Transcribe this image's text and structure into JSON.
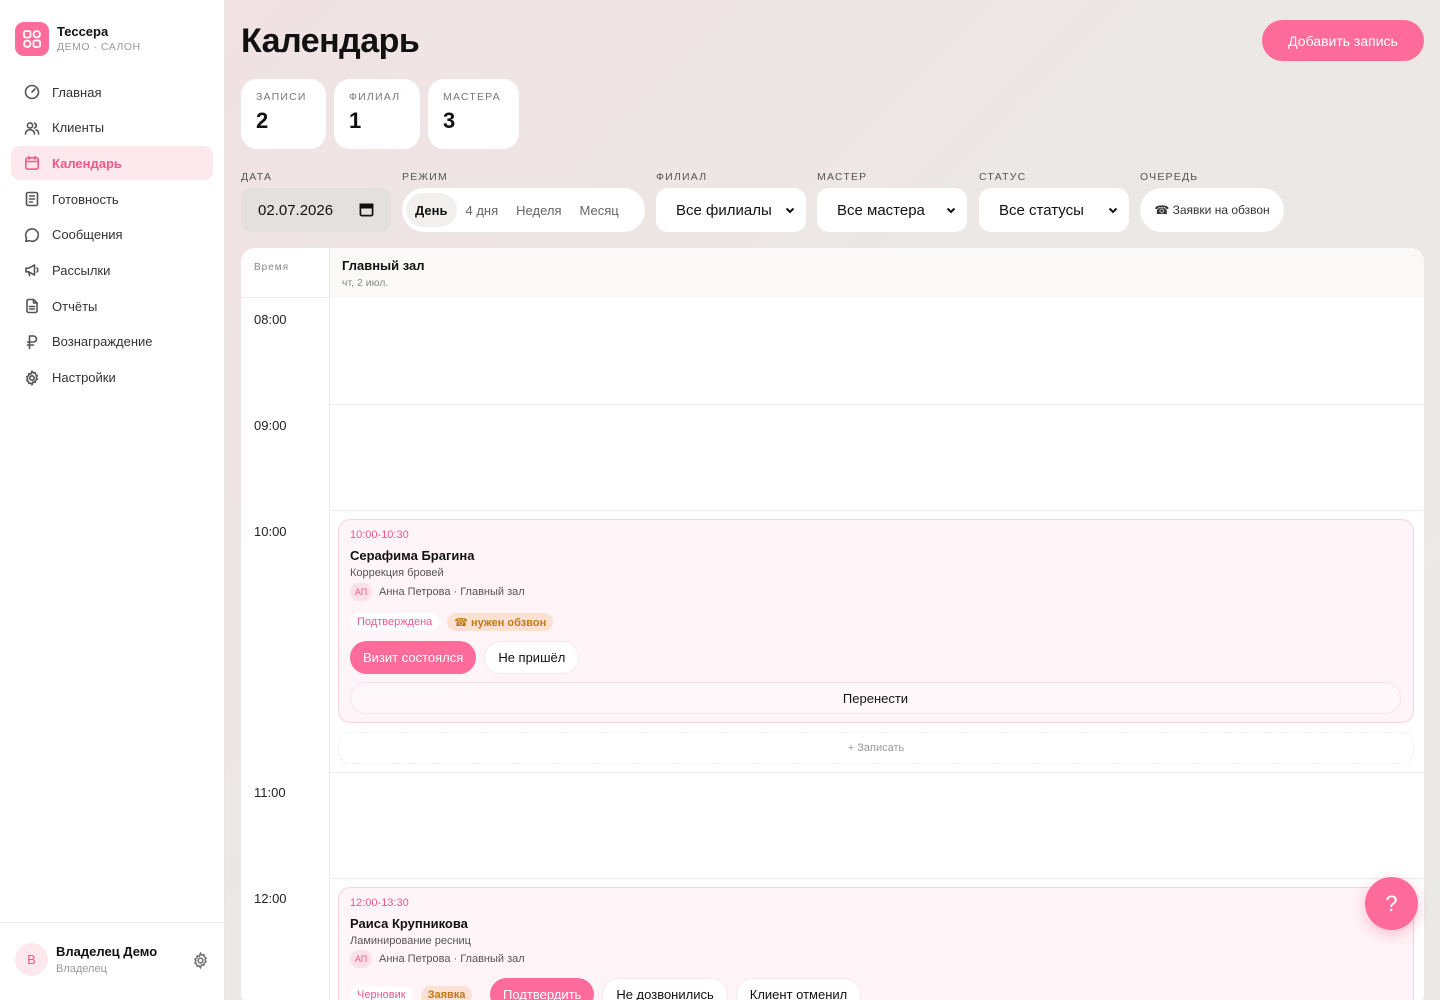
{
  "brand": {
    "name": "Тессера",
    "subtitle": "Демо · салон"
  },
  "nav": [
    {
      "label": "Главная",
      "icon": "gauge-icon"
    },
    {
      "label": "Клиенты",
      "icon": "users-icon"
    },
    {
      "label": "Календарь",
      "icon": "calendar-icon",
      "active": true
    },
    {
      "label": "Готовность",
      "icon": "checklist-icon"
    },
    {
      "label": "Сообщения",
      "icon": "chat-icon"
    },
    {
      "label": "Рассылки",
      "icon": "megaphone-icon"
    },
    {
      "label": "Отчёты",
      "icon": "document-icon"
    },
    {
      "label": "Вознаграждение",
      "icon": "ruble-icon"
    },
    {
      "label": "Настройки",
      "icon": "gear-icon"
    }
  ],
  "user": {
    "initial": "В",
    "name": "Владелец Демо",
    "role": "Владелец"
  },
  "header": {
    "title": "Календарь",
    "add_label": "Добавить запись"
  },
  "stats": [
    {
      "label": "Записи",
      "value": "2"
    },
    {
      "label": "Филиал",
      "value": "1"
    },
    {
      "label": "Мастера",
      "value": "3"
    }
  ],
  "filters": {
    "date_label": "Дата",
    "date_value": "02.07.2026",
    "mode_label": "Режим",
    "modes": [
      "День",
      "4 дня",
      "Неделя",
      "Месяц"
    ],
    "active_mode": "День",
    "branch_label": "Филиал",
    "branch_value": "Все филиалы",
    "master_label": "Мастер",
    "master_value": "Все мастера",
    "status_label": "Статус",
    "status_value": "Все статусы",
    "queue_label": "Очередь",
    "queue_button": "☎ Заявки на обзвон"
  },
  "calendar": {
    "time_header": "Время",
    "room_name": "Главный зал",
    "room_date": "чт, 2 июл.",
    "hours": [
      "08:00",
      "09:00",
      "10:00",
      "11:00",
      "12:00"
    ],
    "book_slot": "+ Записать"
  },
  "appointments": [
    {
      "time": "10:00-10:30",
      "client": "Серафима Брагина",
      "service": "Коррекция бровей",
      "initials": "АП",
      "master": "Анна Петрова · Главный зал",
      "badges": [
        "Подтверждена",
        "☎ нужен обзвон"
      ],
      "buttons": [
        "Визит состоялся",
        "Не пришёл"
      ],
      "move_label": "Перенести"
    },
    {
      "time": "12:00-13:30",
      "client": "Раиса Крупникова",
      "service": "Ламинирование ресниц",
      "initials": "АП",
      "master": "Анна Петрова · Главный зал",
      "badges": [
        "Черновик",
        "Заявка"
      ],
      "buttons": [
        "Подтвердить",
        "Не дозвонились",
        "Клиент отменил"
      ]
    }
  ],
  "help": {
    "label": "?"
  },
  "colors": {
    "accent": "#ff6b9a",
    "accent_text": "#f0588a",
    "warning": "#c07a1a"
  }
}
